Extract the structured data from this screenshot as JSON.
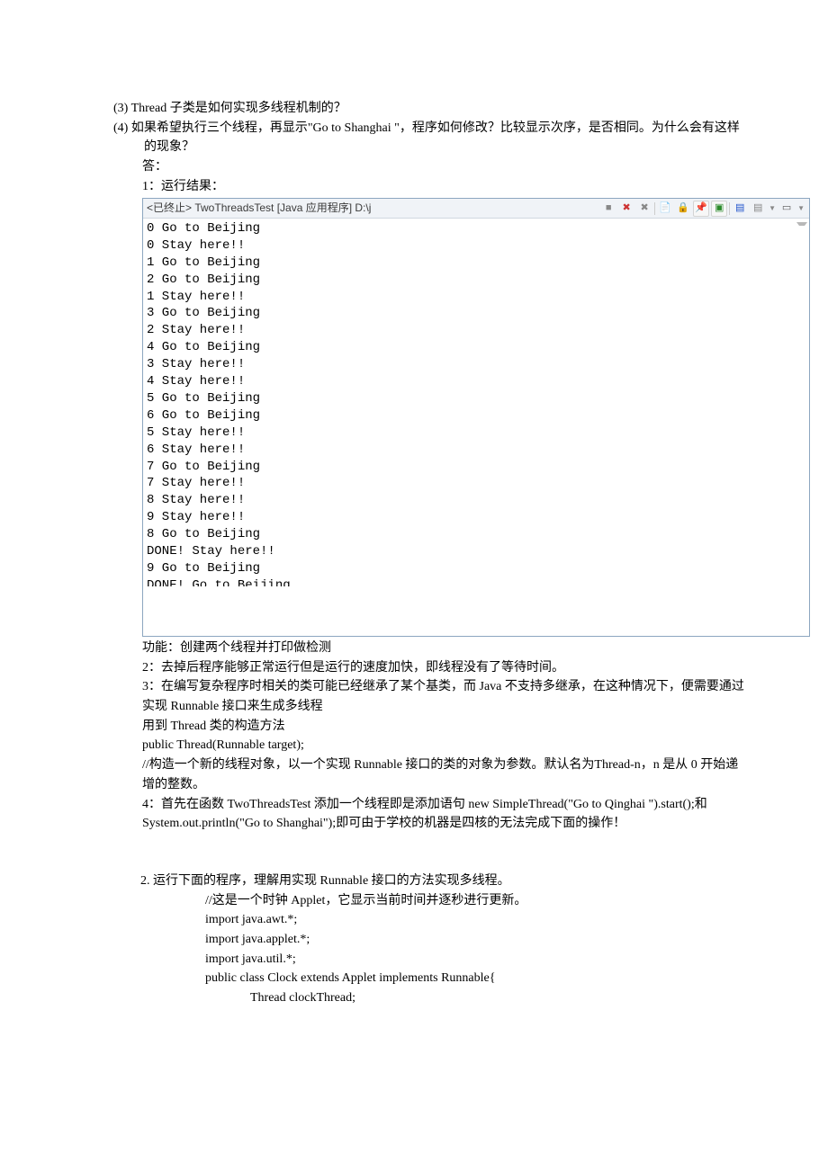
{
  "questions": [
    "(3) Thread 子类是如何实现多线程机制的？",
    "(4) 如果希望执行三个线程，再显示\"Go to Shanghai \"，程序如何修改？比较显示次序，是否相同。为什么会有这样的现象？"
  ],
  "ans_label": "答：",
  "ans_title": "1：运行结果：",
  "console": {
    "header": "<已终止> TwoThreadsTest [Java 应用程序] D:\\j",
    "lines": [
      "0 Go to Beijing",
      "0 Stay here!!",
      "1 Go to Beijing",
      "2 Go to Beijing",
      "1 Stay here!!",
      "3 Go to Beijing",
      "2 Stay here!!",
      "4 Go to Beijing",
      "3 Stay here!!",
      "4 Stay here!!",
      "5 Go to Beijing",
      "6 Go to Beijing",
      "5 Stay here!!",
      "6 Stay here!!",
      "7 Go to Beijing",
      "7 Stay here!!",
      "8 Stay here!!",
      "9 Stay here!!",
      "8 Go to Beijing",
      "DONE! Stay here!!",
      "9 Go to Beijing",
      "DONE! Go to Beijing"
    ]
  },
  "paras": {
    "p0": "功能：创建两个线程并打印做检测",
    "p1": "2：去掉后程序能够正常运行但是运行的速度加快，即线程没有了等待时间。",
    "p2": "3：在编写复杂程序时相关的类可能已经继承了某个基类，而 Java 不支持多继承，在这种情况下，便需要通过实现 Runnable 接口来生成多线程",
    "p3": "用到 Thread 类的构造方法",
    "p4": "public Thread(Runnable target);",
    "p5": " //构造一个新的线程对象，以一个实现 Runnable 接口的类的对象为参数。默认名为Thread-n，n 是从 0 开始递增的整数。",
    "p6": "4：首先在函数 TwoThreadsTest 添加一个线程即是添加语句 new SimpleThread(\"Go to Qinghai \").start();和 System.out.println(\"Go to Shanghai\");即可由于学校的机器是四核的无法完成下面的操作！"
  },
  "q2": {
    "title": "2. 运行下面的程序，理解用实现 Runnable 接口的方法实现多线程。",
    "code": [
      "//这是一个时钟 Applet，它显示当前时间并逐秒进行更新。",
      "import java.awt.*;",
      "import java.applet.*;",
      "import java.util.*;",
      "public class Clock extends Applet implements Runnable{",
      "        Thread clockThread;"
    ]
  }
}
